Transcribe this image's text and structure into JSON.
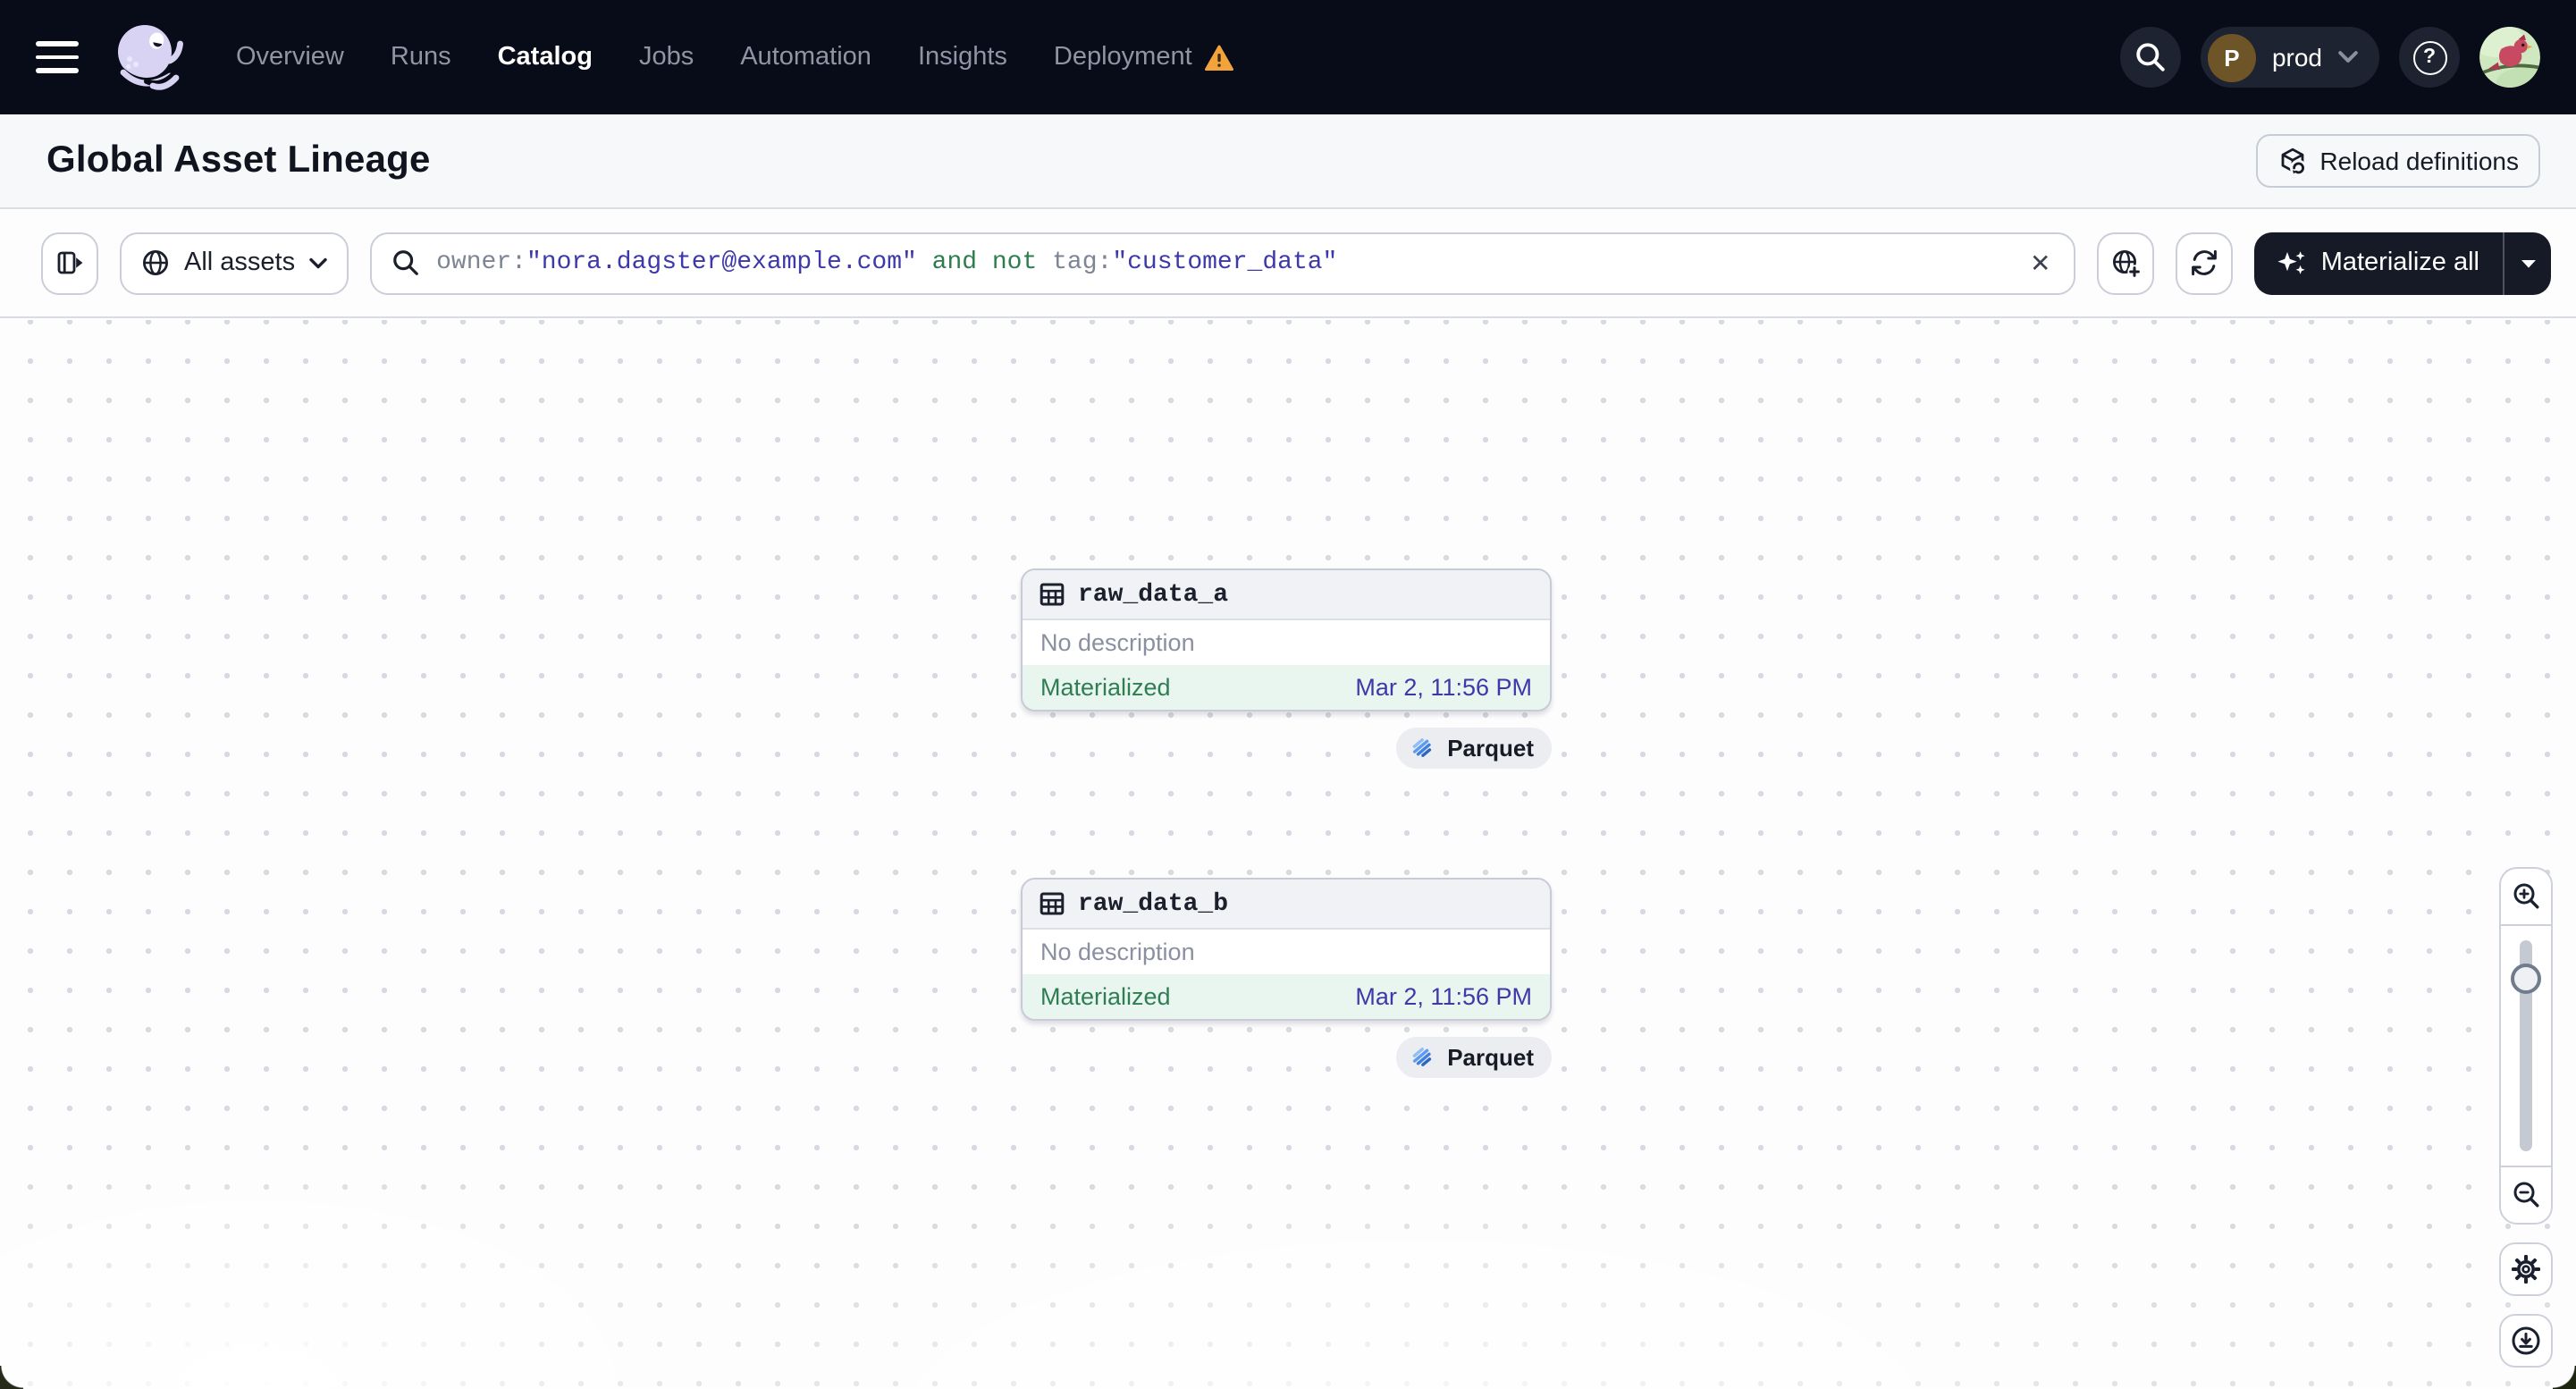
{
  "navbar": {
    "items": [
      {
        "label": "Overview",
        "active": false
      },
      {
        "label": "Runs",
        "active": false
      },
      {
        "label": "Catalog",
        "active": true
      },
      {
        "label": "Jobs",
        "active": false
      },
      {
        "label": "Automation",
        "active": false
      },
      {
        "label": "Insights",
        "active": false
      },
      {
        "label": "Deployment",
        "active": false,
        "warning": true
      }
    ],
    "deployment_switcher": {
      "initial": "P",
      "name": "prod"
    }
  },
  "header": {
    "title": "Global Asset Lineage",
    "reload_button_label": "Reload definitions"
  },
  "toolbar": {
    "asset_scope_label": "All assets",
    "query": {
      "tokens": [
        {
          "type": "key",
          "text": "owner:"
        },
        {
          "type": "value",
          "text": "\"nora.dagster@example.com\""
        },
        {
          "type": "operator",
          "text": " and not "
        },
        {
          "type": "key",
          "text": "tag:"
        },
        {
          "type": "value",
          "text": "\"customer_data\""
        }
      ]
    },
    "materialize_label": "Materialize all"
  },
  "lineage": {
    "nodes": [
      {
        "name": "raw_data_a",
        "description": "No description",
        "status": "Materialized",
        "materialized_at": "Mar 2, 11:56 PM",
        "storage_tag": "Parquet"
      },
      {
        "name": "raw_data_b",
        "description": "No description",
        "status": "Materialized",
        "materialized_at": "Mar 2, 11:56 PM",
        "storage_tag": "Parquet"
      }
    ]
  },
  "icons": {
    "close": "✕",
    "help": "?"
  },
  "colors": {
    "navbar_bg": "#080B18",
    "accent_indigo": "#3D39A9",
    "operator_green": "#2E7D4F",
    "status_green_text": "#2F7D53",
    "status_green_bg": "#E9F6EF",
    "warning_amber": "#F2A33C",
    "parquet_blue": "#5B9CF0"
  }
}
